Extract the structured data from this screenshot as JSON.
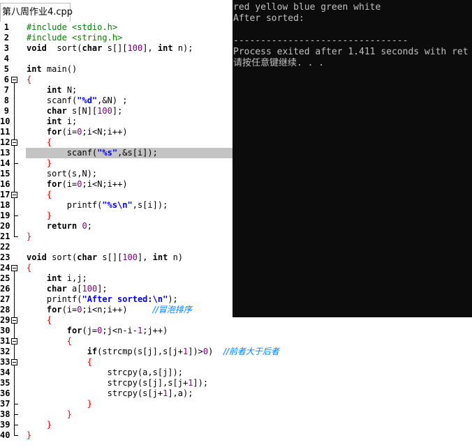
{
  "tab": {
    "label": "第八周作业4.cpp"
  },
  "editor": {
    "highlight_line": 13,
    "lines": [
      {
        "n": "1",
        "code": [
          [
            "pp",
            "#include <stdio.h>"
          ]
        ]
      },
      {
        "n": "2",
        "code": [
          [
            "pp",
            "#include <string.h>"
          ]
        ]
      },
      {
        "n": "3",
        "code": [
          [
            "kw",
            "void"
          ],
          [
            "",
            "  sort("
          ],
          [
            "kw",
            "char"
          ],
          [
            "",
            " s[]["
          ],
          [
            "num",
            "100"
          ],
          [
            "",
            "], "
          ],
          [
            "kw",
            "int"
          ],
          [
            "",
            " n);"
          ]
        ]
      },
      {
        "n": "4",
        "code": []
      },
      {
        "n": "5",
        "code": [
          [
            "kw",
            "int"
          ],
          [
            "",
            " main()"
          ]
        ]
      },
      {
        "n": "6",
        "code": [
          [
            "sym",
            "{"
          ]
        ]
      },
      {
        "n": "7",
        "code": [
          [
            "",
            "    "
          ],
          [
            "kw",
            "int"
          ],
          [
            "",
            " N;"
          ]
        ]
      },
      {
        "n": "8",
        "code": [
          [
            "",
            "    scanf("
          ],
          [
            "str",
            "\"%d\""
          ],
          [
            "",
            ",&N) ;"
          ]
        ]
      },
      {
        "n": "9",
        "code": [
          [
            "",
            "    "
          ],
          [
            "kw",
            "char"
          ],
          [
            "",
            " s[N]["
          ],
          [
            "num",
            "100"
          ],
          [
            "",
            "];"
          ]
        ]
      },
      {
        "n": "10",
        "code": [
          [
            "",
            "    "
          ],
          [
            "kw",
            "int"
          ],
          [
            "",
            " i;"
          ]
        ]
      },
      {
        "n": "11",
        "code": [
          [
            "",
            "    "
          ],
          [
            "kw",
            "for"
          ],
          [
            "",
            "(i="
          ],
          [
            "num",
            "0"
          ],
          [
            "",
            ";i<N;i++)"
          ]
        ]
      },
      {
        "n": "12",
        "code": [
          [
            "",
            "    "
          ],
          [
            "sym",
            "{"
          ]
        ]
      },
      {
        "n": "13",
        "code": [
          [
            "",
            "        scanf("
          ],
          [
            "str",
            "\"%s\""
          ],
          [
            "",
            ",&s[i]);"
          ]
        ]
      },
      {
        "n": "14",
        "code": [
          [
            "",
            "    "
          ],
          [
            "sym",
            "}"
          ]
        ]
      },
      {
        "n": "15",
        "code": [
          [
            "",
            "    sort(s,N);"
          ]
        ]
      },
      {
        "n": "16",
        "code": [
          [
            "",
            "    "
          ],
          [
            "kw",
            "for"
          ],
          [
            "",
            "(i="
          ],
          [
            "num",
            "0"
          ],
          [
            "",
            ";i<N;i++)"
          ]
        ]
      },
      {
        "n": "17",
        "code": [
          [
            "",
            "    "
          ],
          [
            "sym",
            "{"
          ]
        ]
      },
      {
        "n": "18",
        "code": [
          [
            "",
            "        printf("
          ],
          [
            "str",
            "\"%s\\n\""
          ],
          [
            "",
            ",s[i]);"
          ]
        ]
      },
      {
        "n": "19",
        "code": [
          [
            "",
            "    "
          ],
          [
            "sym",
            "}"
          ]
        ]
      },
      {
        "n": "20",
        "code": [
          [
            "",
            "    "
          ],
          [
            "kw",
            "return"
          ],
          [
            "",
            " "
          ],
          [
            "num",
            "0"
          ],
          [
            "",
            ";"
          ]
        ]
      },
      {
        "n": "21",
        "code": [
          [
            "sym",
            "}"
          ]
        ]
      },
      {
        "n": "22",
        "code": []
      },
      {
        "n": "23",
        "code": [
          [
            "kw",
            "void"
          ],
          [
            "",
            " sort("
          ],
          [
            "kw",
            "char"
          ],
          [
            "",
            " s[]["
          ],
          [
            "num",
            "100"
          ],
          [
            "",
            "], "
          ],
          [
            "kw",
            "int"
          ],
          [
            "",
            " n)"
          ]
        ]
      },
      {
        "n": "24",
        "code": [
          [
            "sym",
            "{"
          ]
        ]
      },
      {
        "n": "25",
        "code": [
          [
            "",
            "    "
          ],
          [
            "kw",
            "int"
          ],
          [
            "",
            " i,j;"
          ]
        ]
      },
      {
        "n": "26",
        "code": [
          [
            "",
            "    "
          ],
          [
            "kw",
            "char"
          ],
          [
            "",
            " a["
          ],
          [
            "num",
            "100"
          ],
          [
            "",
            "];"
          ]
        ]
      },
      {
        "n": "27",
        "code": [
          [
            "",
            "    printf("
          ],
          [
            "str",
            "\"After sorted:\\n\""
          ],
          [
            "",
            ");"
          ]
        ]
      },
      {
        "n": "28",
        "code": [
          [
            "",
            "    "
          ],
          [
            "kw",
            "for"
          ],
          [
            "",
            "(i="
          ],
          [
            "num",
            "0"
          ],
          [
            "",
            ";i<n;i++)     "
          ],
          [
            "cmt",
            "//冒泡排序"
          ]
        ]
      },
      {
        "n": "29",
        "code": [
          [
            "",
            "    "
          ],
          [
            "sym",
            "{"
          ]
        ]
      },
      {
        "n": "30",
        "code": [
          [
            "",
            "        "
          ],
          [
            "kw",
            "for"
          ],
          [
            "",
            "(j="
          ],
          [
            "num",
            "0"
          ],
          [
            "",
            ";j<n-i-"
          ],
          [
            "num",
            "1"
          ],
          [
            "",
            ";j++)"
          ]
        ]
      },
      {
        "n": "31",
        "code": [
          [
            "",
            "        "
          ],
          [
            "sym",
            "{"
          ]
        ]
      },
      {
        "n": "32",
        "code": [
          [
            "",
            "            "
          ],
          [
            "kw",
            "if"
          ],
          [
            "",
            "(strcmp(s[j],s[j+"
          ],
          [
            "num",
            "1"
          ],
          [
            "",
            "])>"
          ],
          [
            "num",
            "0"
          ],
          [
            "",
            ")  "
          ],
          [
            "cmt",
            "//前者大于后者"
          ]
        ]
      },
      {
        "n": "33",
        "code": [
          [
            "",
            "            "
          ],
          [
            "sym",
            "{"
          ]
        ]
      },
      {
        "n": "34",
        "code": [
          [
            "",
            "                strcpy(a,s[j]);"
          ]
        ]
      },
      {
        "n": "35",
        "code": [
          [
            "",
            "                strcpy(s[j],s[j+"
          ],
          [
            "num",
            "1"
          ],
          [
            "",
            "]);"
          ]
        ]
      },
      {
        "n": "36",
        "code": [
          [
            "",
            "                strcpy(s[j+"
          ],
          [
            "num",
            "1"
          ],
          [
            "",
            "],a);"
          ]
        ]
      },
      {
        "n": "37",
        "code": [
          [
            "",
            "            "
          ],
          [
            "sym",
            "}"
          ]
        ]
      },
      {
        "n": "38",
        "code": [
          [
            "",
            "        "
          ],
          [
            "sym",
            "}"
          ]
        ]
      },
      {
        "n": "39",
        "code": [
          [
            "",
            "    "
          ],
          [
            "sym",
            "}"
          ]
        ]
      },
      {
        "n": "40",
        "code": [
          [
            "sym",
            "}"
          ]
        ]
      }
    ],
    "folds": [
      [
        6,
        21
      ],
      [
        12,
        14
      ],
      [
        17,
        19
      ],
      [
        24,
        40
      ],
      [
        29,
        39
      ],
      [
        31,
        38
      ],
      [
        33,
        37
      ]
    ]
  },
  "console": {
    "lines": [
      "red yellow blue green white",
      "After sorted:",
      "",
      "--------------------------------",
      "Process exited after 1.411 seconds with ret",
      "请按任意键继续. . ."
    ]
  },
  "colors": {
    "keyword": "#000000",
    "preprocessor": "#008000",
    "string": "#0000ff",
    "number": "#800080",
    "brace": "#ff0000",
    "comment": "#0080ff",
    "highlight": "#c4c4c4",
    "console_bg": "#0c0c0c",
    "console_fg": "#c0c0c0"
  }
}
